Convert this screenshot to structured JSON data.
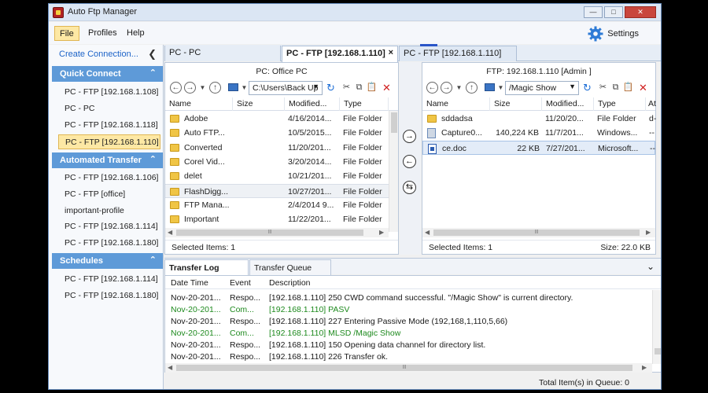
{
  "window": {
    "title": "Auto Ftp Manager"
  },
  "menu": {
    "file": "File",
    "profiles": "Profiles",
    "help": "Help",
    "settings": "Settings"
  },
  "sidebar": {
    "create_connection": "Create Connection...",
    "quick_connect": {
      "header": "Quick Connect",
      "items": [
        "PC - FTP [192.168.1.108]",
        "PC - PC",
        "PC - FTP [192.168.1.118]",
        "PC - FTP [192.168.1.110]"
      ]
    },
    "automated_transfer": {
      "header": "Automated Transfer",
      "items": [
        "PC - FTP [192.168.1.106]",
        "PC - FTP [office]",
        "important-profile",
        "PC - FTP [192.168.1.114]",
        "PC - FTP [192.168.1.180]"
      ]
    },
    "schedules": {
      "header": "Schedules",
      "items": [
        "PC - FTP [192.168.1.114]",
        "PC - FTP [192.168.1.180]"
      ]
    }
  },
  "tabs": [
    "PC - PC",
    "PC - FTP [192.168.1.110]",
    "PC - FTP [192.168.1.110]"
  ],
  "tab_close": "×",
  "local_pane": {
    "title": "PC: Office PC",
    "path": "C:\\Users\\Back Up",
    "columns": [
      "Name",
      "Size",
      "Modified...",
      "Type"
    ],
    "rows": [
      {
        "name": "Adobe",
        "size": "",
        "modified": "4/16/2014...",
        "type": "File Folder"
      },
      {
        "name": "Auto FTP...",
        "size": "",
        "modified": "10/5/2015...",
        "type": "File Folder"
      },
      {
        "name": "Converted",
        "size": "",
        "modified": "11/20/201...",
        "type": "File Folder"
      },
      {
        "name": "Corel Vid...",
        "size": "",
        "modified": "3/20/2014...",
        "type": "File Folder"
      },
      {
        "name": "delet",
        "size": "",
        "modified": "10/21/201...",
        "type": "File Folder"
      },
      {
        "name": "FlashDigg...",
        "size": "",
        "modified": "10/27/201...",
        "type": "File Folder"
      },
      {
        "name": "FTP Mana...",
        "size": "",
        "modified": "2/4/2014 9...",
        "type": "File Folder"
      },
      {
        "name": "Important",
        "size": "",
        "modified": "11/22/201...",
        "type": "File Folder"
      }
    ],
    "status": "Selected Items: 1",
    "hscroll_grip": "Ⅲ"
  },
  "remote_pane": {
    "title": "FTP: 192.168.1.110 [Admin ]",
    "path": "/Magic Show",
    "columns": [
      "Name",
      "Size",
      "Modified...",
      "Type",
      "At"
    ],
    "rows": [
      {
        "name": "sddadsa",
        "size": "",
        "modified": "11/20/20...",
        "type": "File Folder",
        "attr": "d-"
      },
      {
        "name": "Capture0...",
        "size": "140,224 KB",
        "modified": "11/7/201...",
        "type": "Windows...",
        "attr": "--"
      },
      {
        "name": "ce.doc",
        "size": "22 KB",
        "modified": "7/27/201...",
        "type": "Microsoft...",
        "attr": "--"
      }
    ],
    "status": "Selected Items: 1",
    "size_status": "Size: 22.0 KB",
    "hscroll_grip": "Ⅲ"
  },
  "log": {
    "tabs": [
      "Transfer Log",
      "Transfer Queue"
    ],
    "columns": [
      "Date Time",
      "Event",
      "Description"
    ],
    "rows": [
      {
        "date": "Nov-20-201...",
        "event": "Respo...",
        "desc": "[192.168.1.110] 250 CWD command successful. \"/Magic Show\" is current directory.",
        "green": false
      },
      {
        "date": "Nov-20-201...",
        "event": "Com...",
        "desc": "[192.168.1.110] PASV",
        "green": true
      },
      {
        "date": "Nov-20-201...",
        "event": "Respo...",
        "desc": "[192.168.1.110] 227 Entering Passive Mode (192,168,1,110,5,66)",
        "green": false
      },
      {
        "date": "Nov-20-201...",
        "event": "Com...",
        "desc": "[192.168.1.110] MLSD /Magic Show",
        "green": true
      },
      {
        "date": "Nov-20-201...",
        "event": "Respo...",
        "desc": "[192.168.1.110] 150 Opening data channel for directory list.",
        "green": false
      },
      {
        "date": "Nov-20-201...",
        "event": "Respo...",
        "desc": "[192.168.1.110] 226 Transfer ok.",
        "green": false
      }
    ],
    "hscroll_grip": "Ⅲ"
  },
  "status_bar": {
    "queue": "Total Item(s) in Queue: 0"
  },
  "colors": {
    "accent": "#5e9ad8",
    "selected": "#fde8a4",
    "command_text": "#1e8a1e",
    "close": "#c9463d"
  }
}
